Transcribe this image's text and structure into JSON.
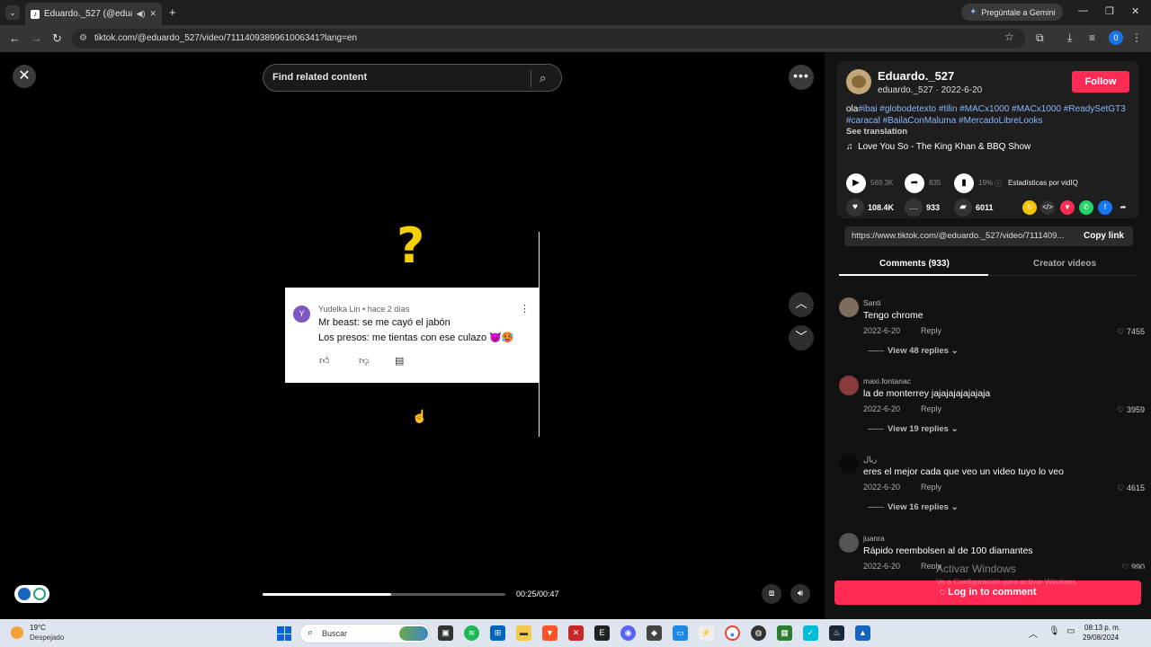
{
  "browser": {
    "tab_title": "Eduardo._527 (@eduardo_",
    "gemini_label": "Pregúntale a Gemini",
    "url": "tiktok.com/@eduardo_527/video/7111409389961006341?lang=en",
    "profile_initial": "0"
  },
  "video": {
    "search_placeholder": "Find related content",
    "question_mark": "?",
    "yt_comment": {
      "avatar_letter": "Y",
      "meta": "Yudelka Lin • hace 2 días",
      "line1": "Mr beast: se me cayó el jabón",
      "line2": "Los presos: me tientas con ese culazo 😈🥵"
    },
    "progress": 0.53,
    "time": "00:25/00:47"
  },
  "panel": {
    "author": "Eduardo._527",
    "handle_date": "eduardo._527 · 2022-6-20",
    "follow_label": "Follow",
    "desc_prefix": "ola",
    "hashtags_line1": "#ibai #globodetexto #tilin #MACx1000 #MACx1000 #ReadySetGT3",
    "hashtags_line2": "#caracal #BailaConMaluma #MercadoLibreLooks",
    "see_translation": "See translation",
    "music": "Love You So - The King Khan & BBQ Show",
    "plays": "569.3K",
    "shares_small": "835",
    "percent": "19%",
    "vidiq": "Estadísticas por vidIQ",
    "likes": "108.4K",
    "comments_count": "933",
    "saves": "6011",
    "link_url": "https://www.tiktok.com/@eduardo._527/video/7111409...",
    "copy_link": "Copy link",
    "tab_comments": "Comments (933)",
    "tab_creator": "Creator videos",
    "comments": [
      {
        "user": "Santi",
        "text": "Tengo chrome",
        "date": "2022-6-20",
        "reply": "Reply",
        "likes": "7455",
        "view_replies": "View 48 replies"
      },
      {
        "user": "maxi.fontanac",
        "text": "la de monterrey jajajajajajajaja",
        "date": "2022-6-20",
        "reply": "Reply",
        "likes": "3959",
        "view_replies": "View 19 replies"
      },
      {
        "user": "ريال",
        "text": "eres el mejor cada que veo un video tuyo lo veo",
        "date": "2022-6-20",
        "reply": "Reply",
        "likes": "4615",
        "view_replies": "View 16 replies"
      },
      {
        "user": "juanra",
        "text": "Rápido reembolsen al de 100 diamantes",
        "date": "2022-6-20",
        "reply": "Reply",
        "likes": "990",
        "view_replies": ""
      }
    ],
    "login_label": "Log in to comment",
    "watermark_title": "Activar Windows",
    "watermark_sub": "Ve a Configuración para activar Windows."
  },
  "taskbar": {
    "temp": "19°C",
    "weather": "Despejado",
    "search_label": "Buscar",
    "time": "08:13 p. m.",
    "date": "29/08/2024"
  }
}
